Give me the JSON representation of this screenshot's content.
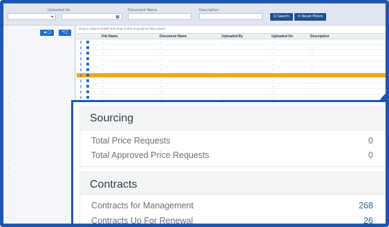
{
  "filters": {
    "uploaded_on_label": "Uploaded On",
    "document_name_label": "Document Name",
    "description_label": "Description",
    "search_button": "Q Search",
    "reset_button": "⟳ Reset Filters"
  },
  "sidebar": {
    "buttons": [
      "▲▢",
      "+▢"
    ],
    "items": [
      "...",
      "...",
      "...",
      "...",
      "...",
      "...",
      "...",
      "...",
      "...",
      "...",
      "...",
      "...",
      "...",
      "...",
      "...",
      "...",
      "...",
      "...",
      "...",
      "...",
      "...",
      "...",
      "...",
      "...",
      "..."
    ]
  },
  "table": {
    "hint": "Drag a column header and drop it here to group by that column",
    "headers": {
      "file_name": "File Name",
      "document_name": "Document Name",
      "uploaded_by": "Uploaded By",
      "uploaded_on": "Uploaded On",
      "description": "Description"
    },
    "rows": [
      {
        "file": "...",
        "doc": "...",
        "by": "...",
        "on": "...",
        "desc": "",
        "selected": false
      },
      {
        "file": "...",
        "doc": "...",
        "by": "",
        "on": "...",
        "desc": "...",
        "selected": false
      },
      {
        "file": "...",
        "doc": "...",
        "by": "",
        "on": "...",
        "desc": "...",
        "selected": false
      },
      {
        "file": "...",
        "doc": "...",
        "by": "",
        "on": "...",
        "desc": "...",
        "selected": false
      },
      {
        "file": "...",
        "doc": "...",
        "by": "",
        "on": "...",
        "desc": "...",
        "selected": false
      },
      {
        "file": "...",
        "doc": "...",
        "by": "",
        "on": "...",
        "desc": "...",
        "selected": false
      },
      {
        "file": "...",
        "doc": "...",
        "by": "...",
        "on": "...",
        "desc": "",
        "selected": true
      },
      {
        "file": "...",
        "doc": "...",
        "by": "",
        "on": "...",
        "desc": "",
        "selected": false
      },
      {
        "file": "...",
        "doc": "...",
        "by": "",
        "on": "...",
        "desc": "...",
        "selected": false
      },
      {
        "file": "...",
        "doc": "...",
        "by": "",
        "on": "...",
        "desc": "...",
        "selected": false
      },
      {
        "file": "...",
        "doc": "...",
        "by": "...",
        "on": "...",
        "desc": "",
        "selected": false
      }
    ]
  },
  "sourcing": {
    "title": "Sourcing",
    "rows": [
      {
        "label": "Total Price Requests",
        "value": "0"
      },
      {
        "label": "Total Approved Price Requests",
        "value": "0"
      }
    ]
  },
  "contracts": {
    "title": "Contracts",
    "rows": [
      {
        "label": "Contracts for Management",
        "value": "268"
      },
      {
        "label": "Contracts Up For Renewal",
        "value": "26"
      }
    ]
  },
  "colors": {
    "brand_blue": "#1d57b3",
    "selected_row": "#f0a81c",
    "value_blue": "#2f5f9e"
  }
}
